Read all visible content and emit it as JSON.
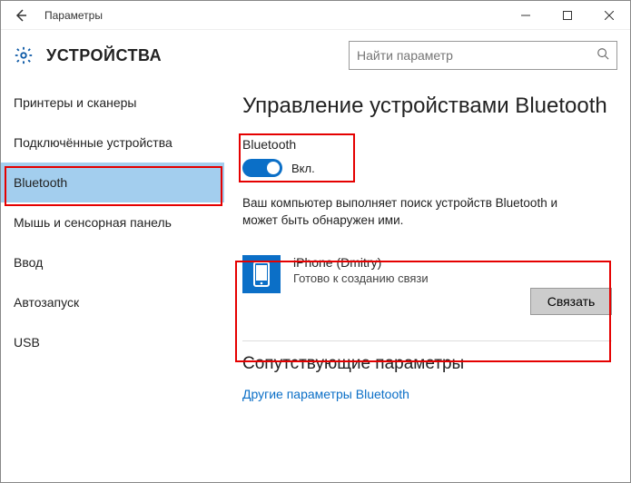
{
  "window": {
    "title": "Параметры"
  },
  "header": {
    "title": "УСТРОЙСТВА",
    "search_placeholder": "Найти параметр"
  },
  "sidebar": {
    "items": [
      {
        "label": "Принтеры и сканеры"
      },
      {
        "label": "Подключённые устройства"
      },
      {
        "label": "Bluetooth"
      },
      {
        "label": "Мышь и сенсорная панель"
      },
      {
        "label": "Ввод"
      },
      {
        "label": "Автозапуск"
      },
      {
        "label": "USB"
      }
    ],
    "active_index": 2
  },
  "main": {
    "page_title": "Управление устройствами Bluetooth",
    "bt_label": "Bluetooth",
    "toggle_state": "Вкл.",
    "desc_line1": "Ваш компьютер выполняет поиск устройств Bluetooth и",
    "desc_line2": "может быть обнаружен ими.",
    "device": {
      "name": "iPhone (Dmitry)",
      "status": "Готово к созданию связи",
      "pair_label": "Связать"
    },
    "related_heading": "Сопутствующие параметры",
    "related_link": "Другие параметры Bluetooth"
  }
}
